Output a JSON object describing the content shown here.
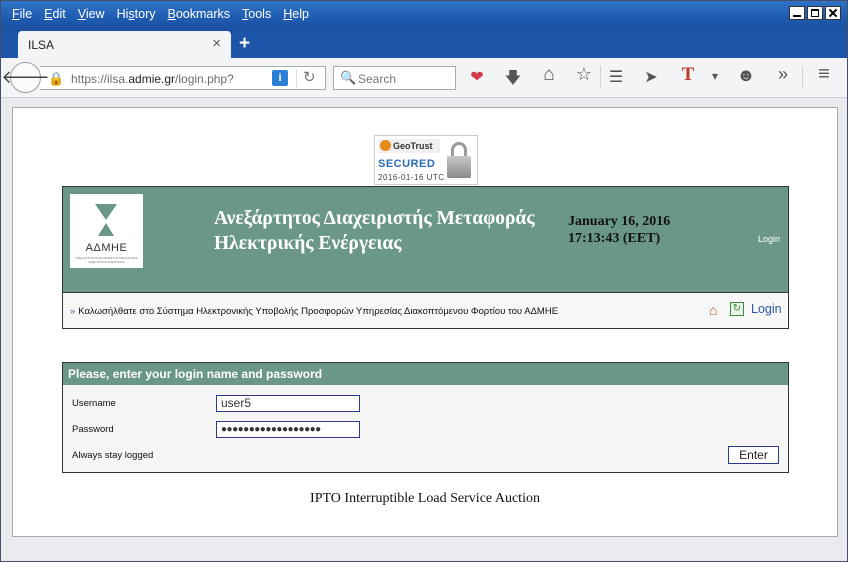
{
  "menu": [
    {
      "key": "F",
      "rest": "ile"
    },
    {
      "key": "E",
      "rest": "dit"
    },
    {
      "key": "V",
      "rest": "iew"
    },
    {
      "key": "",
      "rest": "History",
      "underline_index": 1
    },
    {
      "key": "B",
      "rest": "ookmarks"
    },
    {
      "key": "T",
      "rest": "ools"
    },
    {
      "key": "H",
      "rest": "elp"
    }
  ],
  "tab": {
    "title": "ILSA",
    "close": "×"
  },
  "newtab": "+",
  "nav": {
    "back": "🡐",
    "url_prefix": "https://ilsa.",
    "url_domain": "admie.gr",
    "url_path": "/login.php?",
    "info": "i",
    "reload": "↻",
    "search_placeholder": "Search"
  },
  "icons": {
    "search": "🔍",
    "pocket": "❤",
    "download": "🡇",
    "home": "⌂",
    "star": "☆",
    "reader": "☰",
    "send": "➤",
    "t": "T",
    "dropdown": "▾",
    "emoji": "☻",
    "overflow": "»",
    "menu": "≡"
  },
  "seal": {
    "brand": "GeoTrust",
    "secured": "SECURED",
    "date": "2016-01-16 UTC"
  },
  "header": {
    "logo_text": "ΑΔΜΗΕ",
    "logo_sub": "ΑΝΕΞΑΡΤΗΤΟΣ ΔΙΑΧΕΙΡΙΣΤΗΣ ΜΕΤΑΦΟΡΑΣ ΗΛΕΚΤΡΙΚΗΣ ΕΝΕΡΓΕΙΑΣ",
    "title_line1": "Ανεξάρτητος Διαχειριστής Μεταφοράς",
    "title_line2": "Ηλεκτρικής Ενέργειας",
    "date": "January 16, 2016",
    "time": "17:13:43 (EET)",
    "login": "Login"
  },
  "welcome": {
    "raquo": "»",
    "text": "Καλωσήλθατε στο Σύστημα Ηλεκτρονικής Υποβολής Προσφορών Υπηρεσίας Διακοπτόμενου Φορτίου του ΑΔΜΗΕ",
    "home_icon": "⌂",
    "login_icon": "↻",
    "login": "Login"
  },
  "login_panel": {
    "heading": "Please, enter your login name and password",
    "username_label": "Username",
    "username_value": "user5",
    "password_label": "Password",
    "password_value": "●●●●●●●●●●●●●●●●●●",
    "stay_logged_label": "Always stay logged",
    "enter_label": "Enter"
  },
  "footer": "IPTO Interruptible Load Service Auction"
}
